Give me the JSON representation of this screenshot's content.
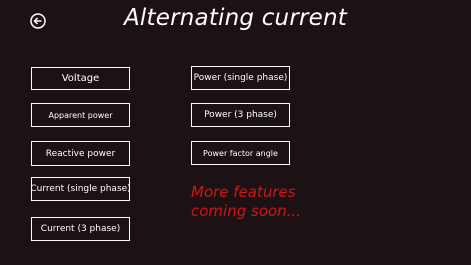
{
  "header": {
    "title": "Alternating current",
    "back_icon": "back-arrow-circle-icon"
  },
  "left_column": [
    {
      "label": "Voltage"
    },
    {
      "label": "Apparent power"
    },
    {
      "label": "Reactive power"
    },
    {
      "label": "Current (single phase)"
    },
    {
      "label": "Current (3 phase)"
    }
  ],
  "right_column": [
    {
      "label": "Power (single phase)"
    },
    {
      "label": "Power (3 phase)"
    },
    {
      "label": "Power factor angle"
    }
  ],
  "promo": {
    "line1": "More features",
    "line2": "coming soon..."
  },
  "colors": {
    "background": "#1d1213",
    "foreground": "#ffffff",
    "promo": "#d01418"
  }
}
